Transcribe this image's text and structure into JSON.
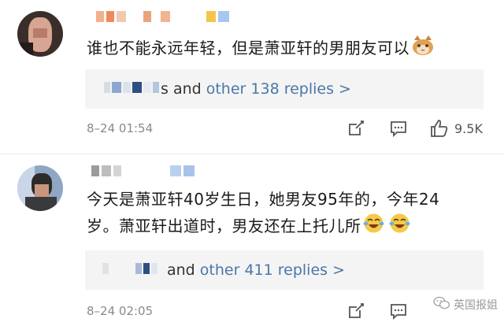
{
  "comments": [
    {
      "text": "谁也不能永远年轻，但是萧亚轩的男朋友可以",
      "replies": {
        "suffix": "s and ",
        "link": "other 138 replies >"
      },
      "timestamp": "8–24 01:54",
      "likes": "9.5K",
      "emoji": "cat-face"
    },
    {
      "text_line1": "今天是萧亚轩40岁生日，她男友95年的，今年24",
      "text_line2": "岁。萧亚轩出道时，男友还在上托儿所",
      "replies": {
        "suffix": "and ",
        "link": "other 411 replies >"
      },
      "timestamp": "8–24 02:05",
      "emoji": "laughing-crying"
    }
  ],
  "watermark": {
    "text": "英国报姐"
  },
  "colors": {
    "link": "#4a77a8",
    "reply_bg": "#f4f4f4",
    "meta": "#8a8a8a"
  },
  "icons": [
    "share-icon",
    "comment-icon",
    "like-icon"
  ]
}
